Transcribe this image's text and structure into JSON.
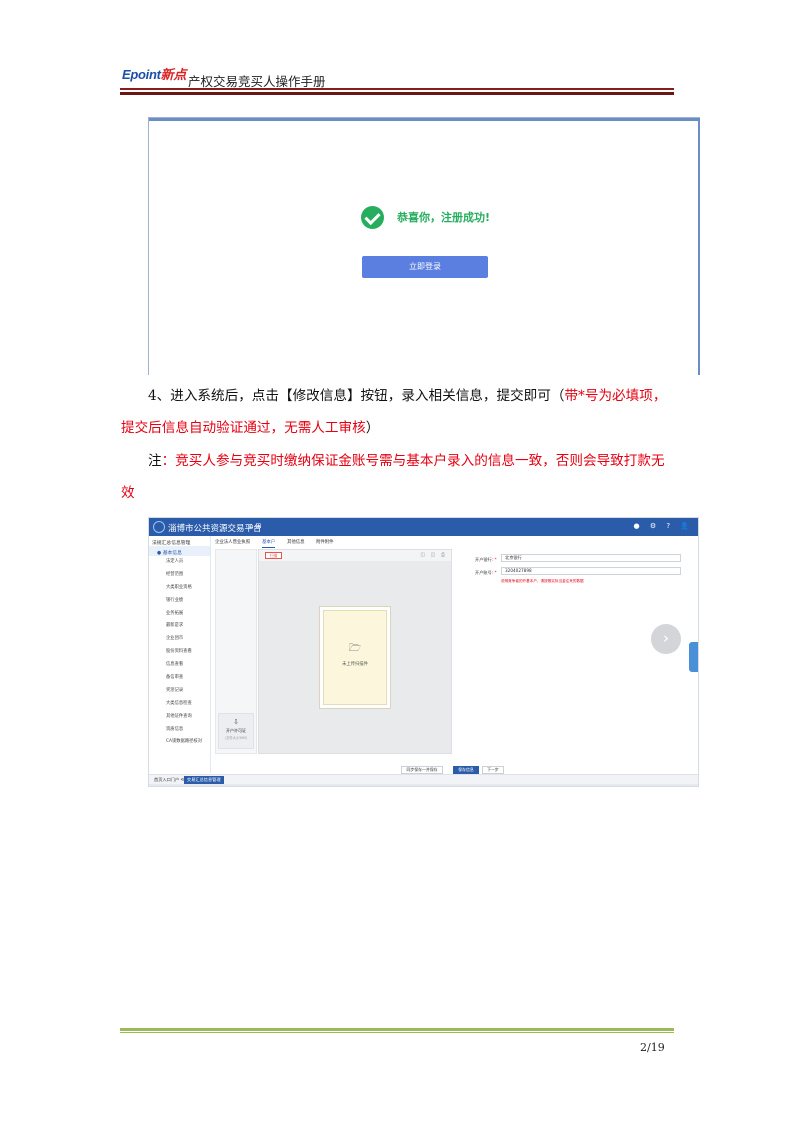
{
  "header": {
    "logo_main": "Epoint",
    "logo_accent": "新点",
    "title": "产权交易竞买人操作手册"
  },
  "screenshot1": {
    "success_text": "恭喜你，注册成功!",
    "login_button": "立即登录",
    "success_color": "#26ad5e",
    "button_color": "#5b7fe0"
  },
  "body": {
    "step4_prefix": "4、进入系统后，点击【修改信息】按钮，录入相关信息，提交即可（",
    "step4_red_1": "带*号为必填项，",
    "step4_red_2": "提交后信息自动验证通过，无需人工审核",
    "step4_suffix": "）",
    "note_label": "注",
    "note_text": "：竞买人参与竞买时缴纳保证金账号需与基本户录入的信息一致，否则会导致打款无",
    "note_text_2": "效",
    "red_color": "#e60012"
  },
  "screenshot2": {
    "platform_title": "淄博市公共资源交易平台",
    "top_icons": "⌂ ⊞",
    "right_icons": "● ⚙ ? 👤",
    "sidebar": {
      "header": "法规汇总信息管理",
      "active": "● 基本信息",
      "items": [
        "法定人员",
        "经营范围",
        "大类职业资格",
        "银行业绩",
        "业务拓展",
        "最新是求",
        "企业团市",
        "股份资料查看",
        "信息查看",
        "备信审查",
        "奖惩记录",
        "大类信息检查",
        "其他证件查询",
        "资质信息",
        "CA锁数据路径核对"
      ]
    },
    "tabs": [
      "企业法人营业执照",
      "基本户",
      "其他信息",
      "附件附件"
    ],
    "upload_button": "扫描",
    "viewer_icons": "◫ ◫ ⎙",
    "page_placeholder": "未上传扫描件",
    "page_icon": "🗁",
    "left_card_title": "开户许可证",
    "left_card_sub": "(文件大小30M)",
    "left_card_icon": "⇩",
    "form": {
      "bank_label": "开户银行:",
      "bank_value": "北京银行",
      "account_label": "开户账号:",
      "account_value": "3204027898",
      "note": "说明竞争者的开基本户，请按照实际当金往来的数据"
    },
    "next_arrow": "›",
    "side_tab_text": "在线客服",
    "footer_buttons": [
      "同步保存一并保存",
      "保存信息",
      "下一步"
    ],
    "bottom_tabs": [
      "首页入口门户 ⟲",
      "交易汇总信息管理"
    ]
  },
  "footer": {
    "page": "2/19"
  }
}
